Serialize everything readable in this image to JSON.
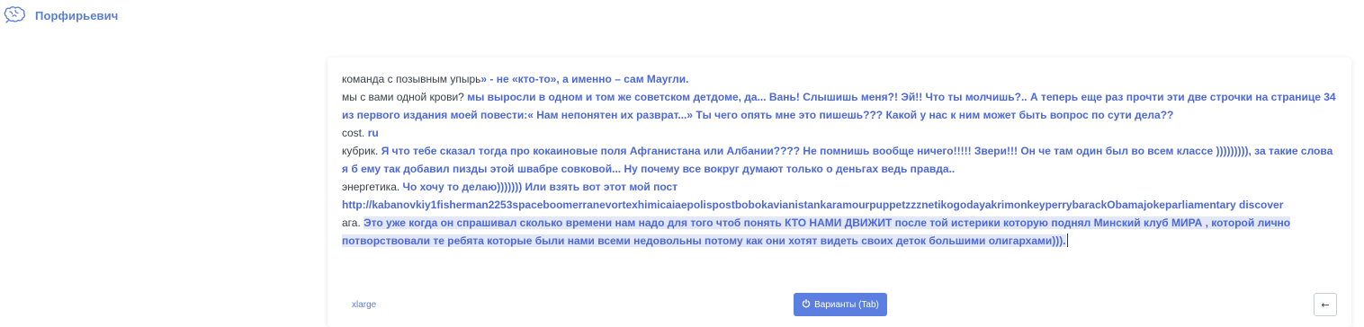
{
  "header": {
    "brand": "Порфирьевич",
    "logo_icon": "brain-icon"
  },
  "editor": {
    "lines": [
      {
        "prompt": "команда с позывным упырь",
        "generated": "» - не «кто-то», а именно – сам Маугли."
      },
      {
        "prompt": "мы с вами одной крови? ",
        "generated": "мы выросли в одном и том же советском детдоме, да... Вань! Слышишь меня?! Эй!! Что ты молчишь?.. А теперь еще раз прочти эти две строчки на странице 34 из первого издания моей повести:« Нам непонятен их разврат...» Ты чего опять мне это пишешь??? Какой у нас к ним может быть вопрос по сути дела??"
      },
      {
        "prompt": "cost. ",
        "generated": "ru"
      },
      {
        "prompt": "кубрик. ",
        "generated": "Я что тебе сказал тогда про кокаиновые поля Афганистана или Албании???? Не помнишь вообще ничего!!!!! Звери!!! Он че там один был во всем классе ))))))))), за такие слова я б ему так добавил пизды этой швабре совковой... Ну почему все вокруг думают только о деньгах ведь правда.."
      },
      {
        "prompt": "энергетика. ",
        "generated": "Чо хочу то делаю))))))) Или взять вот этот мой пост http://kabanovkiy1fisherman2253spaceboomerranevortexhimicaiaepolispostbobokavianistankaramourpuppetzzznetikogodayakrimonkeyperrybarackObamajokeparliamentary discover"
      },
      {
        "prompt": "ага. ",
        "generated": "Это уже когда он спрашивал сколько времени нам надо для того чтоб понять КТО НАМИ ДВИЖИТ после той истерики которую поднял Минский клуб МИРА , которой лично потворствовали те ребята которые были нами всеми недовольны потому как они хотят видеть своих деток большими олигархами)))."
      }
    ]
  },
  "footer": {
    "model_label": "xlarge",
    "variants_button": "Варианты (Tab)",
    "variants_icon": "power-icon",
    "back_icon": "arrow-left-icon",
    "back_glyph": "←"
  },
  "colors": {
    "accent": "#5b7fe0",
    "generated_text": "#4d68d8",
    "highlight": "#e3e8f8"
  }
}
